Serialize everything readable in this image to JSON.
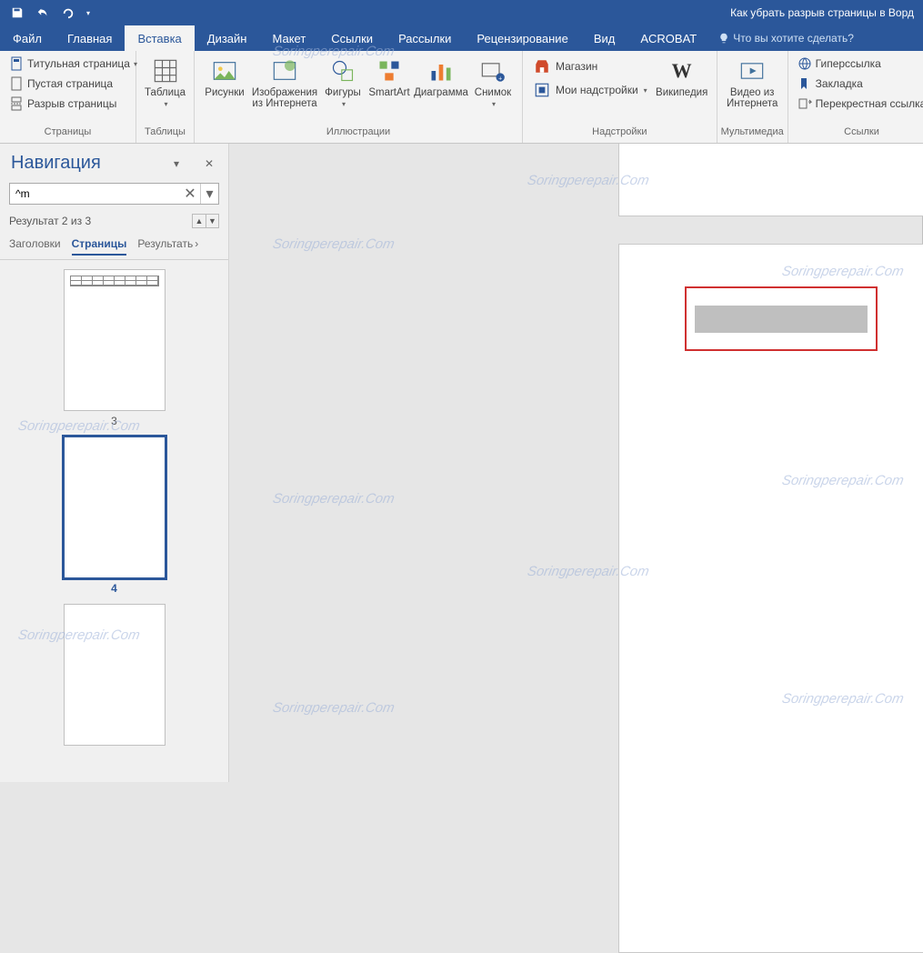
{
  "window_title": "Как убрать разрыв страницы в Ворд",
  "qat": {
    "save": "Save",
    "undo": "Undo",
    "redo": "Redo",
    "customize": "Customize"
  },
  "tabs": [
    {
      "id": "file",
      "label": "Файл"
    },
    {
      "id": "home",
      "label": "Главная"
    },
    {
      "id": "insert",
      "label": "Вставка",
      "active": true
    },
    {
      "id": "design",
      "label": "Дизайн"
    },
    {
      "id": "layout",
      "label": "Макет"
    },
    {
      "id": "references",
      "label": "Ссылки"
    },
    {
      "id": "mailings",
      "label": "Рассылки"
    },
    {
      "id": "review",
      "label": "Рецензирование"
    },
    {
      "id": "view",
      "label": "Вид"
    },
    {
      "id": "acrobat",
      "label": "ACROBAT"
    }
  ],
  "tell_me": "Что вы хотите сделать?",
  "ribbon": {
    "pages": {
      "label": "Страницы",
      "cover_page": "Титульная страница",
      "blank_page": "Пустая страница",
      "page_break": "Разрыв страницы"
    },
    "tables": {
      "label": "Таблицы",
      "table": "Таблица"
    },
    "illustrations": {
      "label": "Иллюстрации",
      "pictures": "Рисунки",
      "online_pictures_l1": "Изображения",
      "online_pictures_l2": "из Интернета",
      "shapes": "Фигуры",
      "smartart": "SmartArt",
      "chart": "Диаграмма",
      "screenshot": "Снимок"
    },
    "addins": {
      "label": "Надстройки",
      "store": "Магазин",
      "my_addins": "Мои надстройки",
      "wikipedia": "Википедия"
    },
    "media": {
      "label": "Мультимедиа",
      "online_video_l1": "Видео из",
      "online_video_l2": "Интернета"
    },
    "links": {
      "label": "Ссылки",
      "hyperlink": "Гиперссылка",
      "bookmark": "Закладка",
      "crossref": "Перекрестная ссылка"
    }
  },
  "nav": {
    "title": "Навигация",
    "search_value": "^m",
    "results_text": "Результат 2 из 3",
    "tabs": {
      "headings": "Заголовки",
      "pages": "Страницы",
      "results": "Результать"
    },
    "thumbs": [
      {
        "num": "3",
        "has_table": true,
        "selected": false
      },
      {
        "num": "4",
        "has_table": false,
        "selected": true
      },
      {
        "num": "",
        "has_table": false,
        "selected": false
      }
    ]
  },
  "watermark": "Soringperepair.Com",
  "colors": {
    "primary": "#2b579a",
    "bg": "#e6e6e6",
    "selection_border": "#d03030"
  }
}
